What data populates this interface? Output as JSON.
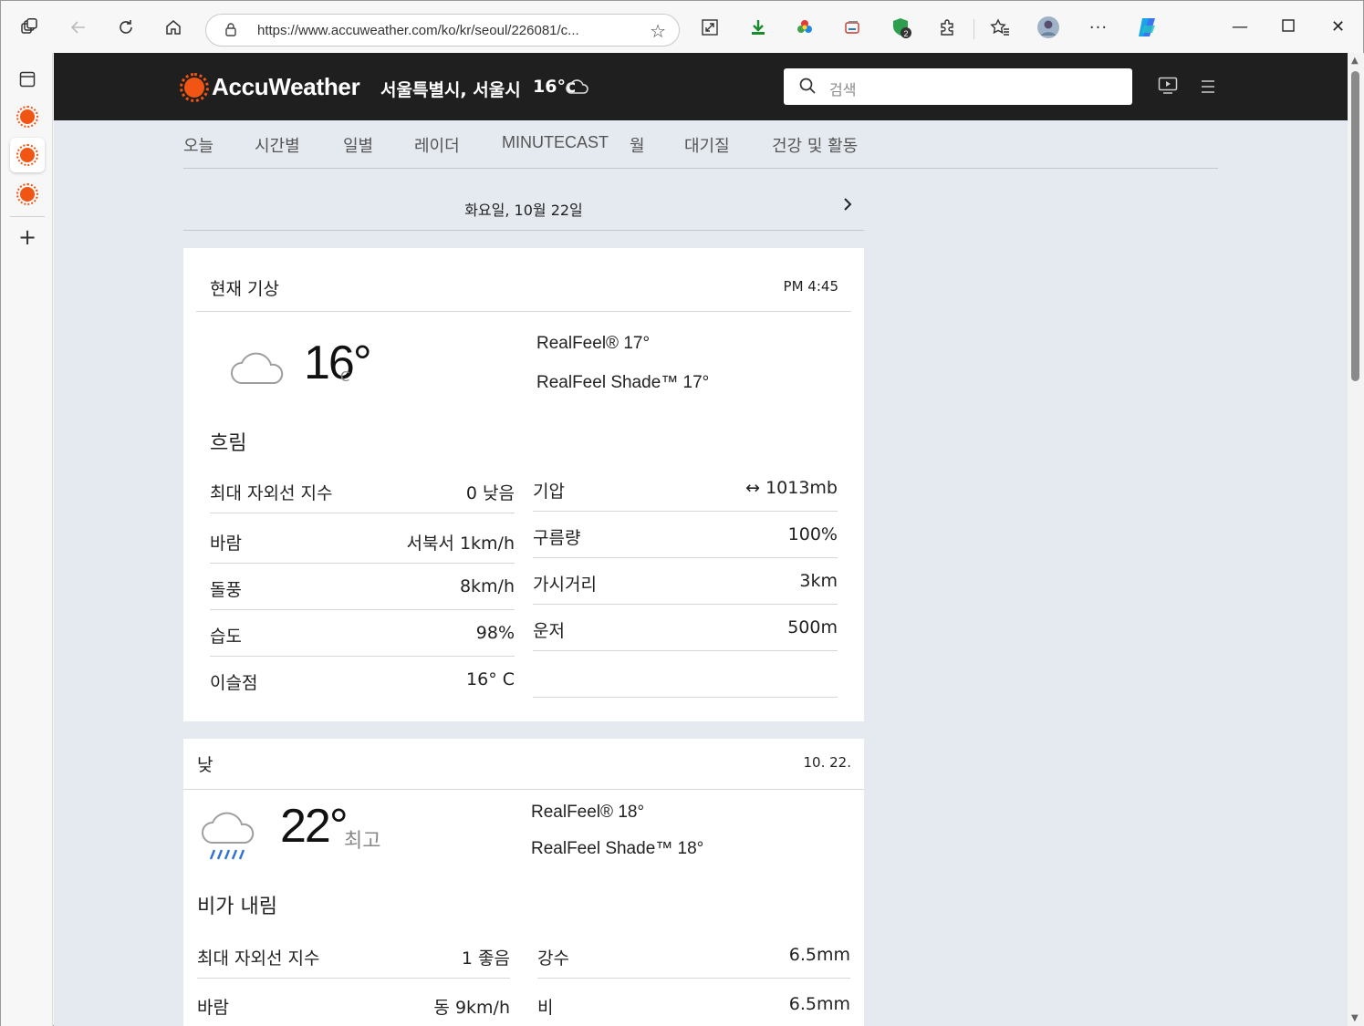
{
  "browser": {
    "url": "https://www.accuweather.com/ko/kr/seoul/226081/c...",
    "extension_badge": "2"
  },
  "header": {
    "brand": "AccuWeather",
    "location": "서울특별시, 서울시",
    "location_temp": "16°c",
    "search_placeholder": "검색"
  },
  "nav": {
    "items": [
      "오늘",
      "시간별",
      "일별",
      "레이더",
      "MINUTECAST",
      "월",
      "대기질",
      "건강 및 활동"
    ]
  },
  "date_bar": {
    "label": "화요일, 10월 22일"
  },
  "current": {
    "title": "현재 기상",
    "time": "PM 4:45",
    "temp": "16°",
    "unit": "C",
    "realfeel": "RealFeel® 17°",
    "realfeel_shade": "RealFeel Shade™ 17°",
    "phrase": "흐림",
    "left_rows": [
      {
        "label": "최대 자외선 지수",
        "value": "0 낮음"
      },
      {
        "label": "바람",
        "value": "서북서 1km/h"
      },
      {
        "label": "돌풍",
        "value": "8km/h"
      },
      {
        "label": "습도",
        "value": "98%"
      },
      {
        "label": "이슬점",
        "value": "16° C"
      }
    ],
    "right_rows": [
      {
        "label": "기압",
        "value": "↔ 1013mb"
      },
      {
        "label": "구름량",
        "value": "100%"
      },
      {
        "label": "가시거리",
        "value": "3km"
      },
      {
        "label": "운저",
        "value": "500m"
      },
      {
        "label": "",
        "value": ""
      }
    ]
  },
  "day": {
    "title": "낮",
    "date": "10. 22.",
    "temp": "22°",
    "hi_label": "최고",
    "realfeel": "RealFeel® 18°",
    "realfeel_shade": "RealFeel Shade™ 18°",
    "phrase": "비가 내림",
    "left_rows": [
      {
        "label": "최대 자외선 지수",
        "value": "1 좋음"
      },
      {
        "label": "바람",
        "value": "동 9km/h"
      }
    ],
    "right_rows": [
      {
        "label": "강수",
        "value": "6.5mm"
      },
      {
        "label": "비",
        "value": "6.5mm"
      }
    ]
  }
}
